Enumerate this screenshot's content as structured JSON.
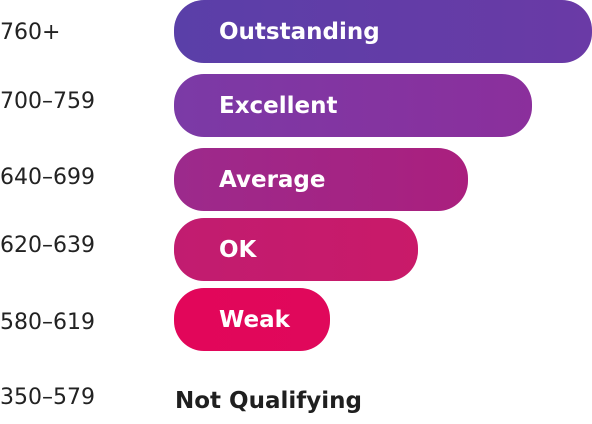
{
  "tiers": [
    {
      "range": "760+",
      "label": "Outstanding",
      "color_start": "#5b3ea8",
      "color_end": "#6a3aa6"
    },
    {
      "range": "700–759",
      "label": "Excellent",
      "color_start": "#7b3aa6",
      "color_end": "#8b2f9c"
    },
    {
      "range": "640–699",
      "label": "Average",
      "color_start": "#9c2a8c",
      "color_end": "#a91f7e"
    },
    {
      "range": "620–639",
      "label": "OK",
      "color_start": "#c31b6e",
      "color_end": "#c81a6a"
    },
    {
      "range": "580–619",
      "label": "Weak",
      "color_start": "#e2065a",
      "color_end": "#e0085b"
    },
    {
      "range": "350–579",
      "label": "Not Qualifying"
    }
  ]
}
